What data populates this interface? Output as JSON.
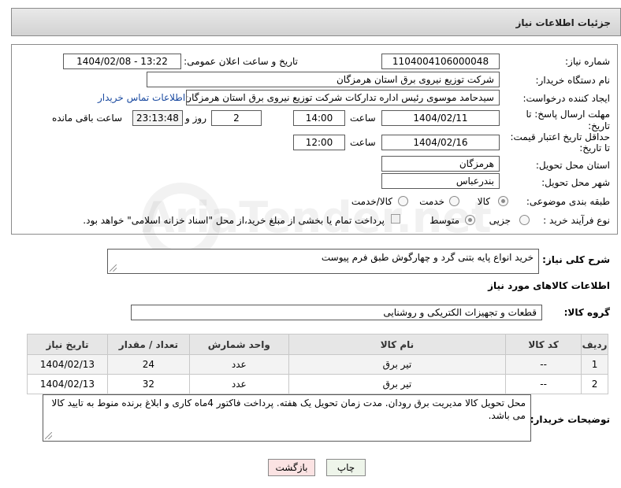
{
  "header": {
    "title": "جزئیات اطلاعات نیاز"
  },
  "fields": {
    "need_number_label": "شماره نیاز:",
    "need_number": "1104004106000048",
    "announce_label": "تاریخ و ساعت اعلان عمومی:",
    "announce_value": "1404/02/08 - 13:22",
    "buyer_org_label": "نام دستگاه خریدار:",
    "buyer_org": "شرکت توزیع نیروی برق استان هرمزگان",
    "creator_label": "ایجاد کننده درخواست:",
    "creator": "سیدحامد موسوی رئیس اداره تدارکات شرکت توزیع نیروی برق استان هرمزگان",
    "contact_link": "اطلاعات تماس خریدار",
    "deadline_label": "مهلت ارسال پاسخ: تا تاریخ:",
    "deadline_date": "1404/02/11",
    "time_label": "ساعت",
    "deadline_time": "14:00",
    "days_value": "2",
    "days_label": "روز و",
    "remaining_time": "23:13:48",
    "remaining_label": "ساعت باقی مانده",
    "validity_label": "حداقل تاریخ اعتبار قیمت: تا تاریخ:",
    "validity_date": "1404/02/16",
    "validity_time": "12:00",
    "province_label": "استان محل تحویل:",
    "province": "هرمزگان",
    "city_label": "شهر محل تحویل:",
    "city": "بندرعباس",
    "category_label": "طبقه بندی موضوعی:",
    "category_options": [
      "کالا",
      "خدمت",
      "کالا/خدمت"
    ],
    "category_selected": "کالا",
    "process_label": "نوع فرآیند خرید :",
    "process_options": [
      "جزیی",
      "متوسط"
    ],
    "process_selected": "متوسط",
    "payment_note": "پرداخت تمام یا بخشی از مبلغ خرید،از محل \"اسناد خزانه اسلامی\" خواهد بود."
  },
  "summary": {
    "label": "شرح کلی نیاز:",
    "text": "خرید انواع پایه بتنی گرد و چهارگوش طبق فرم پیوست"
  },
  "goods": {
    "section_title": "اطلاعات کالاهای مورد نیاز",
    "group_label": "گروه کالا:",
    "group_value": "قطعات و تجهیزات الکتریکی و روشنایی",
    "columns": [
      "ردیف",
      "کد کالا",
      "نام کالا",
      "واحد شمارش",
      "تعداد / مقدار",
      "تاریخ نیاز"
    ],
    "rows": [
      [
        "1",
        "--",
        "تیر برق",
        "عدد",
        "24",
        "1404/02/13"
      ],
      [
        "2",
        "--",
        "تیر برق",
        "عدد",
        "32",
        "1404/02/13"
      ]
    ]
  },
  "buyer_notes": {
    "label": "توضیحات خریدار:",
    "text": "محل تحویل کالا مدیریت برق رودان. مدت زمان تحویل یک هفته. پرداخت فاکتور 4ماه کاری و ابلاغ برنده منوط به تایید کالا می باشد."
  },
  "buttons": {
    "print": "چاپ",
    "back": "بازگشت"
  },
  "watermark": "AriaTender.net",
  "colors": {
    "link": "#1a4aa0",
    "print_button": "#eef5ea",
    "back_button": "#fbe3e3"
  }
}
